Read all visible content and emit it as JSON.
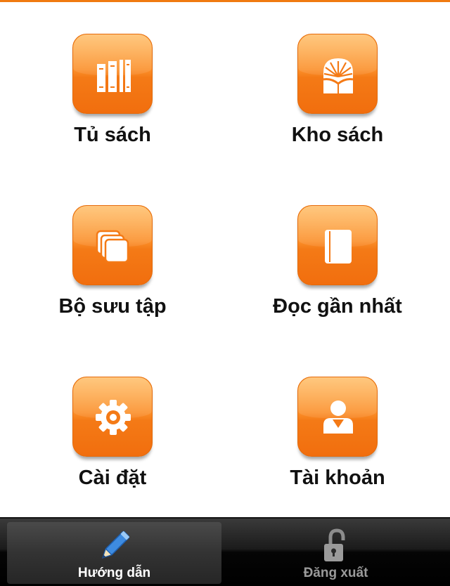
{
  "menu": {
    "items": [
      {
        "label": "Tủ sách",
        "icon": "bookshelf-icon"
      },
      {
        "label": "Kho sách",
        "icon": "book-store-icon"
      },
      {
        "label": "Bộ sưu tập",
        "icon": "collection-icon"
      },
      {
        "label": "Đọc gần nhất",
        "icon": "recent-book-icon"
      },
      {
        "label": "Cài đặt",
        "icon": "gear-icon"
      },
      {
        "label": "Tài khoản",
        "icon": "user-icon"
      }
    ]
  },
  "tabbar": {
    "tabs": [
      {
        "label": "Hướng dẫn",
        "icon": "pencil-icon",
        "active": true
      },
      {
        "label": "Đăng xuất",
        "icon": "unlock-icon",
        "active": false
      }
    ]
  },
  "colors": {
    "accent": "#f47a16",
    "tabbar": "#000000",
    "label": "#111111"
  }
}
